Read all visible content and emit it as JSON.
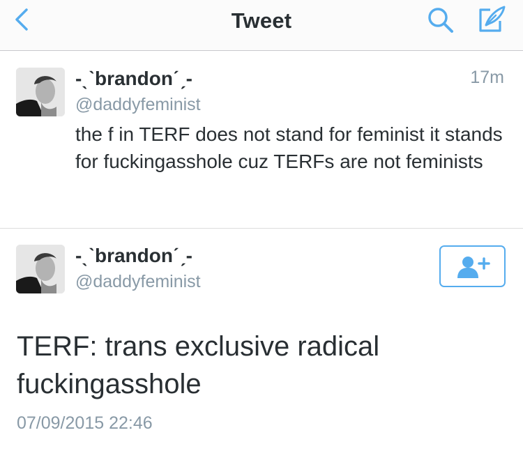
{
  "nav": {
    "title": "Tweet",
    "back_icon": "chevron-left-icon",
    "search_icon": "search-icon",
    "compose_icon": "compose-icon",
    "accent_color": "#55acee"
  },
  "tweet_reply": {
    "display_name": "-ˎˋbrandonˊˏ-",
    "handle": "@daddyfeminist",
    "time": "17m",
    "text": "the f in TERF does not stand for feminist it stands for fuckingasshole cuz TERFs are not feminists"
  },
  "tweet_main": {
    "display_name": "-ˎˋbrandonˊˏ-",
    "handle": "@daddyfeminist",
    "follow_icon": "add-user-icon",
    "text": "TERF: trans exclusive radical fuckingasshole",
    "date": "07/09/2015 22:46"
  }
}
